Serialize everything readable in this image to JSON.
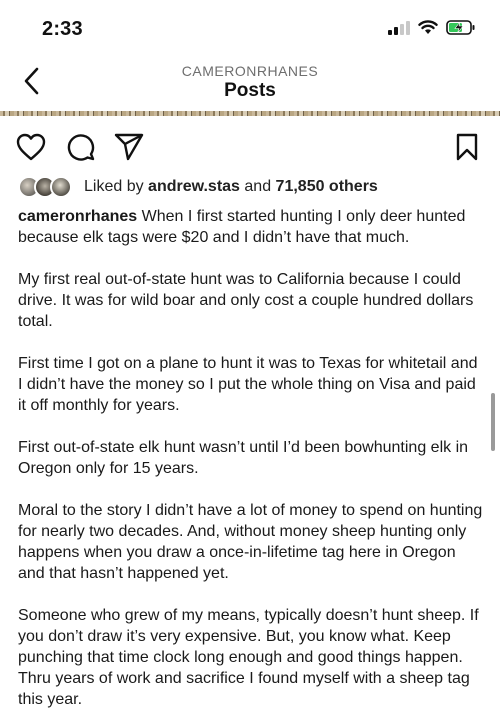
{
  "status_bar": {
    "time": "2:33",
    "icons": [
      "signal-icon",
      "wifi-icon",
      "battery-charging-icon"
    ]
  },
  "header": {
    "subtitle": "CAMERONRHANES",
    "title": "Posts",
    "back_icon": "chevron-left-icon"
  },
  "actions": {
    "icons": [
      "heart-icon",
      "comment-icon",
      "share-icon",
      "bookmark-icon"
    ]
  },
  "likes": {
    "prefix": "Liked by",
    "user": "andrew.stas",
    "middle": "and",
    "count": "71,850 others"
  },
  "caption": {
    "username": "cameronrhanes",
    "first_paragraph": "When I first started hunting I only deer hunted because elk tags were $20 and I didn’t have that much.",
    "paragraphs": [
      "My first real out-of-state hunt was to California because I could drive. It was for wild boar and only cost a couple hundred dollars total.",
      "First time I got on a plane to hunt it was to Texas for whitetail and I didn’t have the money so I put the whole thing on Visa and paid it off monthly for years.",
      "First out-of-state elk hunt wasn’t until I’d been bowhunting elk in Oregon only for 15 years.",
      "Moral to the story I didn’t have a lot of money to spend on hunting for nearly two decades. And, without money sheep hunting only happens when you draw a once-in-lifetime tag here in Oregon and that hasn’t happened yet.",
      "Someone who grew of my means, typically doesn’t hunt sheep. If you don’t draw it’s very expensive. But, you know what. Keep punching that time clock long enough and good things happen. Thru years of work and sacrifice I found myself with a sheep tag this year."
    ]
  },
  "colors": {
    "text": "#111111",
    "secondary_text": "#6e6e6e",
    "background": "#ffffff"
  }
}
